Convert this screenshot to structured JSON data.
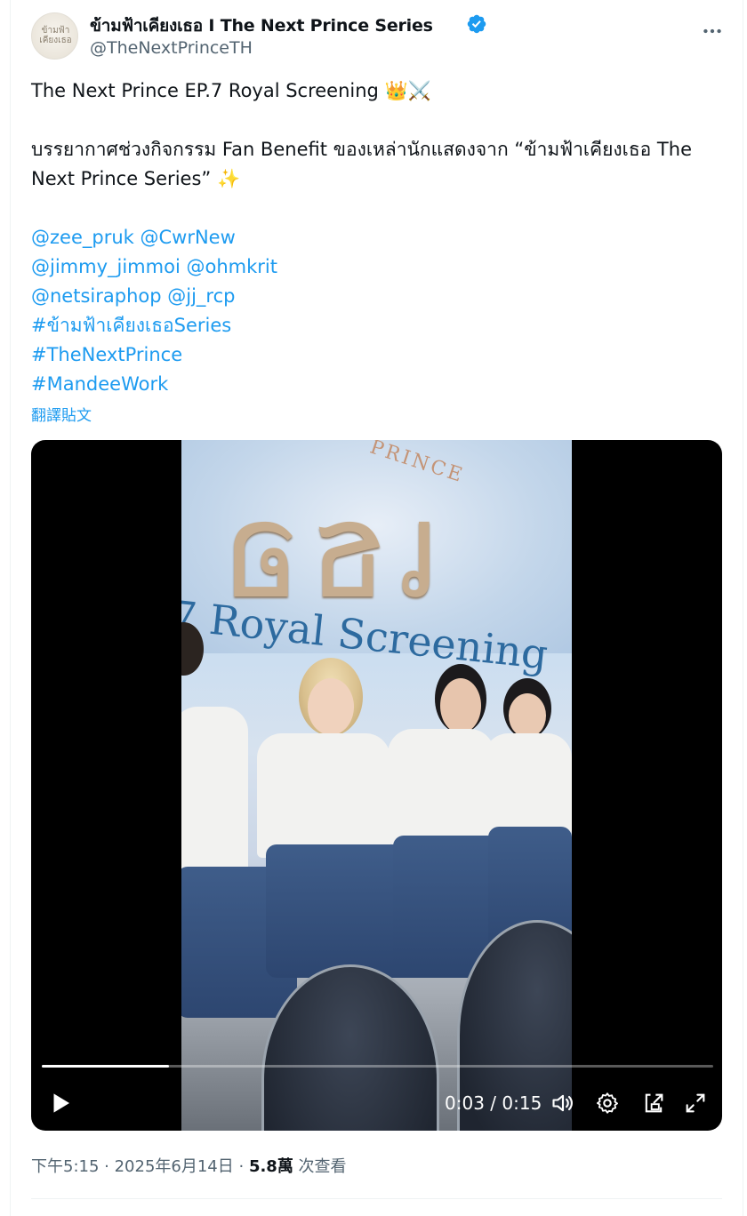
{
  "account": {
    "display_name": "ข้ามฟ้าเคียงเธอ I The Next Prince Series",
    "handle": "@TheNextPrinceTH",
    "avatar_text_line1": "ข้ามฟ้า",
    "avatar_text_line2": "เคียงเธอ",
    "verified_icon": "verified-badge-icon",
    "verified_color": "#1d9bf0"
  },
  "tweet": {
    "line1": "The Next Prince EP.7 Royal Screening 👑⚔️",
    "line2": "บรรยากาศช่วงกิจกรรม Fan Benefit ของเหล่านักแสดงจาก “ข้ามฟ้าเคียงเธอ The",
    "line3": "Next Prince Series” ✨",
    "mentions_row1": [
      "@zee_pruk",
      "@CwrNew"
    ],
    "mentions_row2": [
      "@jimmy_jimmoi",
      "@ohmkrit"
    ],
    "mentions_row3": [
      "@netsiraphop",
      "@jj_rcp"
    ],
    "hashtags": [
      "#ข้ามฟ้าเคียงเธอSeries",
      "#TheNextPrince",
      "#MandeeWork"
    ],
    "translate_label": "翻譯貼文"
  },
  "video": {
    "banner_text": "7 Royal Screening",
    "banner_word": "PRINCE",
    "current_time": "0:03",
    "separator": " / ",
    "duration": "0:15",
    "progress_fraction": 0.19
  },
  "footer": {
    "time": "下午5:15",
    "dot": " · ",
    "date": "2025年6月14日",
    "views_count": "5.8萬",
    "views_label": " 次查看"
  },
  "colors": {
    "link": "#1d9bf0",
    "secondary_text": "#536471",
    "primary_text": "#0f1419"
  }
}
